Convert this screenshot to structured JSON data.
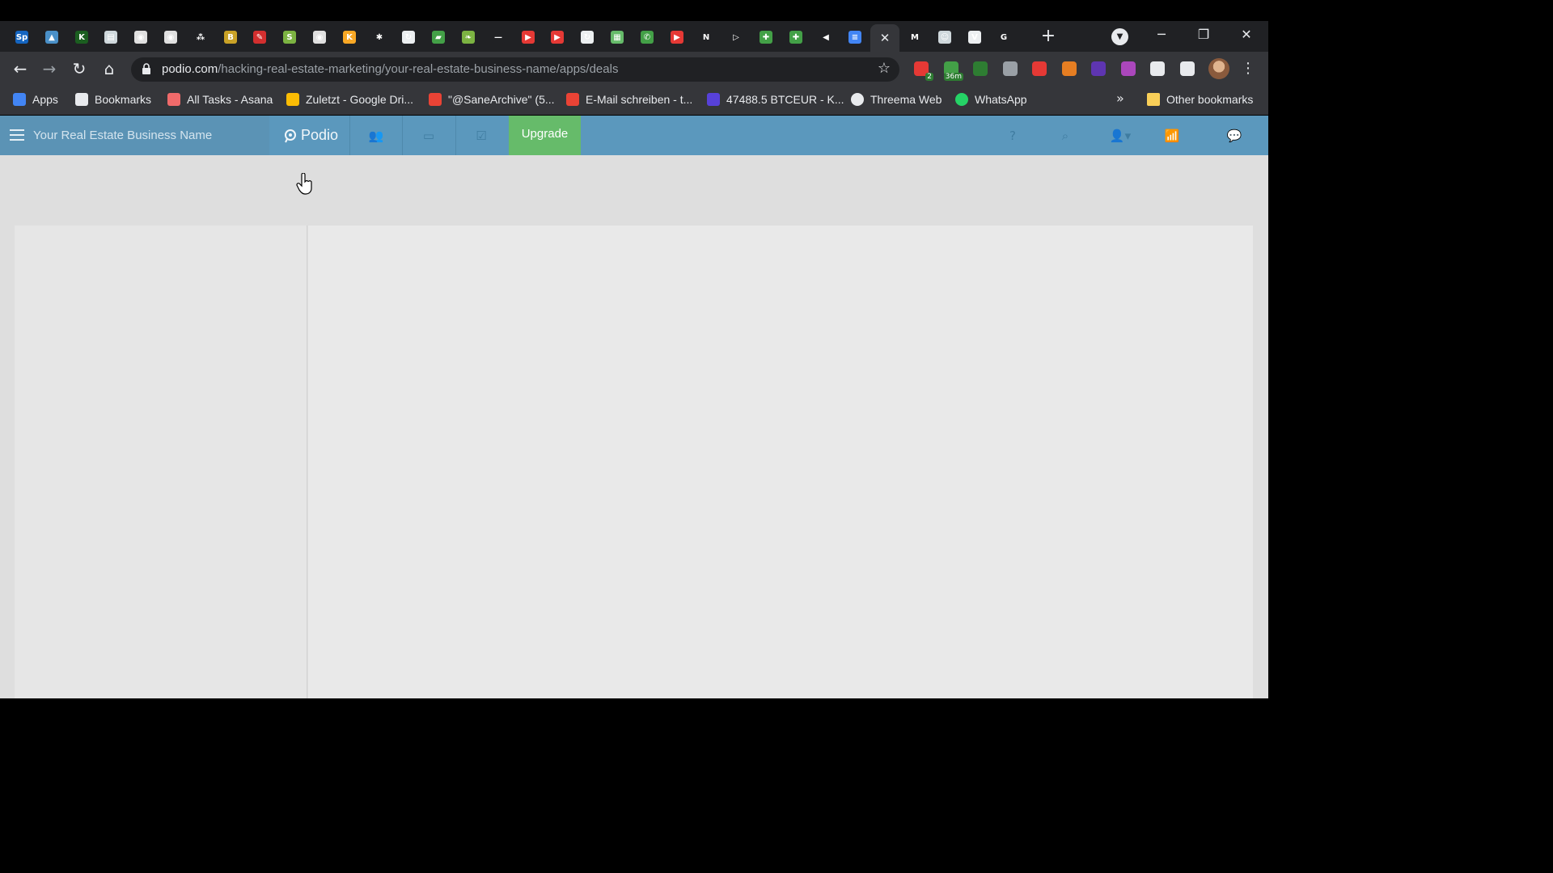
{
  "browser": {
    "tabs": [
      {
        "icon": "sp-icon",
        "color": "#1565c0",
        "glyph": "Sp"
      },
      {
        "icon": "image-icon",
        "color": "#4a90c8",
        "glyph": "▲"
      },
      {
        "icon": "phone-icon",
        "color": "#1b5e20",
        "glyph": "K"
      },
      {
        "icon": "document-icon",
        "color": "#cfd8dc",
        "glyph": "▤"
      },
      {
        "icon": "globe-icon",
        "color": "#e0e0e0",
        "glyph": "◉"
      },
      {
        "icon": "globe-icon",
        "color": "#e0e0e0",
        "glyph": "◉"
      },
      {
        "icon": "asana-icon",
        "color": "#202124",
        "glyph": "⁂"
      },
      {
        "icon": "badge-icon",
        "color": "#c9a227",
        "glyph": "B"
      },
      {
        "icon": "pen-icon",
        "color": "#d32f2f",
        "glyph": "✎"
      },
      {
        "icon": "shopify-icon",
        "color": "#7cb342",
        "glyph": "S"
      },
      {
        "icon": "globe-icon",
        "color": "#e0e0e0",
        "glyph": "◉"
      },
      {
        "icon": "keep-icon",
        "color": "#f9a825",
        "glyph": "K"
      },
      {
        "icon": "star-burst-icon",
        "color": "#202124",
        "glyph": "✱"
      },
      {
        "icon": "refresh-box-icon",
        "color": "#eceff1",
        "glyph": "↻"
      },
      {
        "icon": "android-icon",
        "color": "#43a047",
        "glyph": "▰"
      },
      {
        "icon": "leaf-icon",
        "color": "#7cb342",
        "glyph": "❧"
      },
      {
        "icon": "dash-icon",
        "color": "#202124",
        "glyph": "—"
      },
      {
        "icon": "youtube-icon",
        "color": "#e53935",
        "glyph": "▶"
      },
      {
        "icon": "youtube-icon",
        "color": "#e53935",
        "glyph": "▶"
      },
      {
        "icon": "refresh-box-icon",
        "color": "#eceff1",
        "glyph": "↻"
      },
      {
        "icon": "grid-icon",
        "color": "#66bb6a",
        "glyph": "▦"
      },
      {
        "icon": "whatsapp-icon",
        "color": "#43a047",
        "glyph": "✆"
      },
      {
        "icon": "youtube-icon",
        "color": "#e53935",
        "glyph": "▶"
      },
      {
        "icon": "netflix-icon",
        "color": "#202124",
        "glyph": "N"
      },
      {
        "icon": "play-icon",
        "color": "#202124",
        "glyph": "▷"
      },
      {
        "icon": "sheets-icon",
        "color": "#43a047",
        "glyph": "✚"
      },
      {
        "icon": "sheets-icon",
        "color": "#43a047",
        "glyph": "✚"
      },
      {
        "icon": "audio-icon",
        "color": "#202124",
        "glyph": "◀"
      },
      {
        "icon": "docs-icon",
        "color": "#4285f4",
        "glyph": "≡"
      },
      {
        "icon": "close-icon",
        "color": "#35363a",
        "glyph": "✕",
        "active": true
      },
      {
        "icon": "gmail-icon",
        "color": "#202124",
        "glyph": "M"
      },
      {
        "icon": "contacts-icon",
        "color": "#cfd8dc",
        "glyph": "☺"
      },
      {
        "icon": "vdf-icon",
        "color": "#eceff1",
        "glyph": "V"
      },
      {
        "icon": "google-icon",
        "color": "#202124",
        "glyph": "G"
      }
    ],
    "new_tab": "+",
    "url_host": "podio.com",
    "url_path": "/hacking-real-estate-marketing/your-real-estate-business-name/apps/deals",
    "extensions": [
      {
        "icon": "calendar-badge-icon",
        "color": "#e53935",
        "badge": "2"
      },
      {
        "icon": "timer-icon",
        "color": "#43a047",
        "badge": "36m"
      },
      {
        "icon": "evernote-icon",
        "color": "#2e7d32",
        "badge": ""
      },
      {
        "icon": "pocket-icon",
        "color": "#9aa0a6",
        "badge": ""
      },
      {
        "icon": "adblock-icon",
        "color": "#e53935",
        "badge": ""
      },
      {
        "icon": "metamask-icon",
        "color": "#e67e22",
        "badge": ""
      },
      {
        "icon": "grammar-icon",
        "color": "#5e35b1",
        "badge": ""
      },
      {
        "icon": "color-picker-icon",
        "color": "#ab47bc",
        "badge": ""
      },
      {
        "icon": "puzzle-icon",
        "color": "#e8eaed",
        "badge": ""
      },
      {
        "icon": "queue-icon",
        "color": "#e8eaed",
        "badge": ""
      }
    ]
  },
  "bookmarks": [
    {
      "label": "Apps",
      "icon": "apps-grid-icon",
      "color": "#4285f4"
    },
    {
      "label": "Bookmarks",
      "icon": "star-icon",
      "color": "#e8eaed"
    },
    {
      "label": "All Tasks - Asana",
      "icon": "asana-icon",
      "color": "#f06a6a"
    },
    {
      "label": "Zuletzt - Google Dri...",
      "icon": "drive-icon",
      "color": "#fbbc04"
    },
    {
      "label": "\"@SaneArchive\" (5...",
      "icon": "gmail-icon",
      "color": "#ea4335"
    },
    {
      "label": "E-Mail schreiben - t...",
      "icon": "gmail-icon",
      "color": "#ea4335"
    },
    {
      "label": "47488.5 BTCEUR - K...",
      "icon": "kraken-icon",
      "color": "#5741d9"
    },
    {
      "label": "Threema Web",
      "icon": "threema-icon",
      "color": "#e8eaed"
    },
    {
      "label": "WhatsApp",
      "icon": "whatsapp-icon",
      "color": "#25d366"
    }
  ],
  "bookmarks_more": "»",
  "other_bookmarks": "Other bookmarks",
  "podio": {
    "workspace_name": "Your Real Estate Business Name",
    "logo_text": "Podio",
    "upgrade_label": "Upgrade",
    "accent": "#5b98bd",
    "upgrade_color": "#66bb6a"
  }
}
